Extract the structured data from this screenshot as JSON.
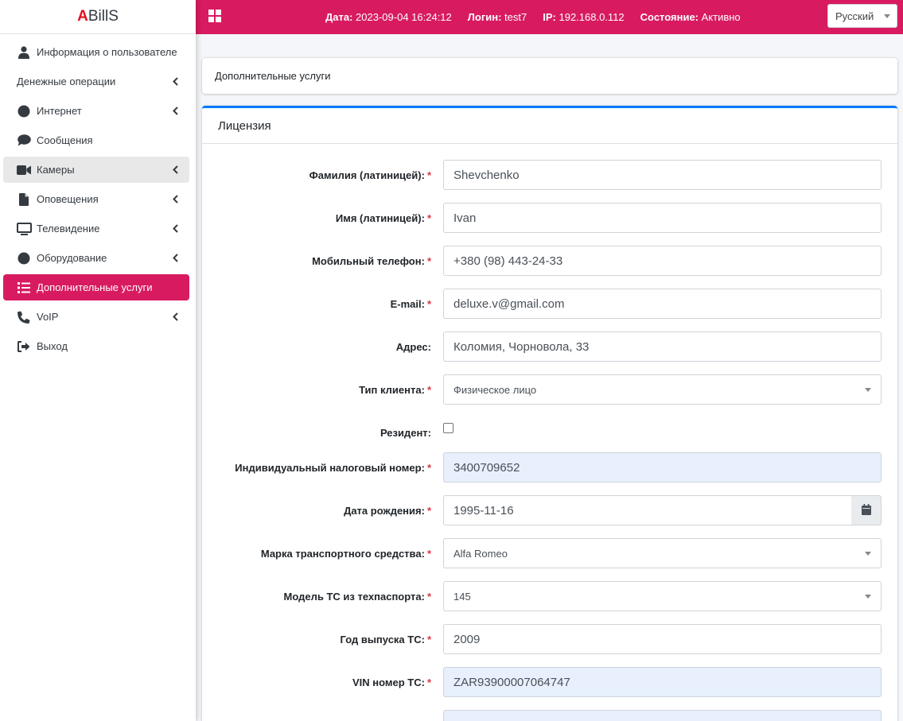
{
  "brand": {
    "first_letter": "A",
    "rest": "BillS"
  },
  "header": {
    "date_label": "Дата:",
    "date_value": "2023-09-04 16:24:12",
    "login_label": "Логин:",
    "login_value": "test7",
    "ip_label": "IP:",
    "ip_value": "192.168.0.112",
    "status_label": "Состояние:",
    "status_value": "Активно",
    "language": "Русский"
  },
  "sidebar": {
    "items": [
      {
        "label": "Информация о пользователе",
        "icon": "user-icon"
      },
      {
        "label": "Денежные операции",
        "icon": ""
      },
      {
        "label": "Интернет",
        "icon": "globe-icon"
      },
      {
        "label": "Сообщения",
        "icon": "comment-icon"
      },
      {
        "label": "Камеры",
        "icon": "video-camera-icon"
      },
      {
        "label": "Оповещения",
        "icon": "file-icon"
      },
      {
        "label": "Телевидение",
        "icon": "tv-icon"
      },
      {
        "label": "Оборудование",
        "icon": "circle-icon"
      },
      {
        "label": "Дополнительные услуги",
        "icon": "list-icon"
      },
      {
        "label": "VoIP",
        "icon": "phone-icon"
      },
      {
        "label": "Выход",
        "icon": "sign-out-icon"
      }
    ]
  },
  "page": {
    "breadcrumb": "Дополнительные услуги",
    "card_title": "Лицензия"
  },
  "form": {
    "lastname_label": "Фамилия (латиницей):",
    "lastname_value": "Shevchenko",
    "firstname_label": "Имя (латиницей):",
    "firstname_value": "Ivan",
    "phone_label": "Мобильный телефон:",
    "phone_value": "+380 (98) 443-24-33",
    "email_label": "E-mail:",
    "email_value": "deluxe.v@gmail.com",
    "address_label": "Адрес:",
    "address_value": "Коломия, Чорновола, 33",
    "client_type_label": "Тип клиента:",
    "client_type_value": "Физическое лицо",
    "resident_label": "Резидент:",
    "tax_label": "Индивидуальный налоговый номер:",
    "tax_value": "3400709652",
    "birth_label": "Дата рождения:",
    "birth_value": "1995-11-16",
    "brand_label": "Марка транспортного средства:",
    "brand_value": "Alfa Romeo",
    "model_label": "Модель ТС из техпаспорта:",
    "model_value": "145",
    "year_label": "Год выпуска ТС:",
    "year_value": "2009",
    "vin_label": "VIN номер ТС:",
    "vin_value": "ZAR93900007064747"
  },
  "colors": {
    "accent": "#d81b60",
    "card_border": "#007bff",
    "required": "#dc3545",
    "brand_letter": "#e50f1f"
  }
}
